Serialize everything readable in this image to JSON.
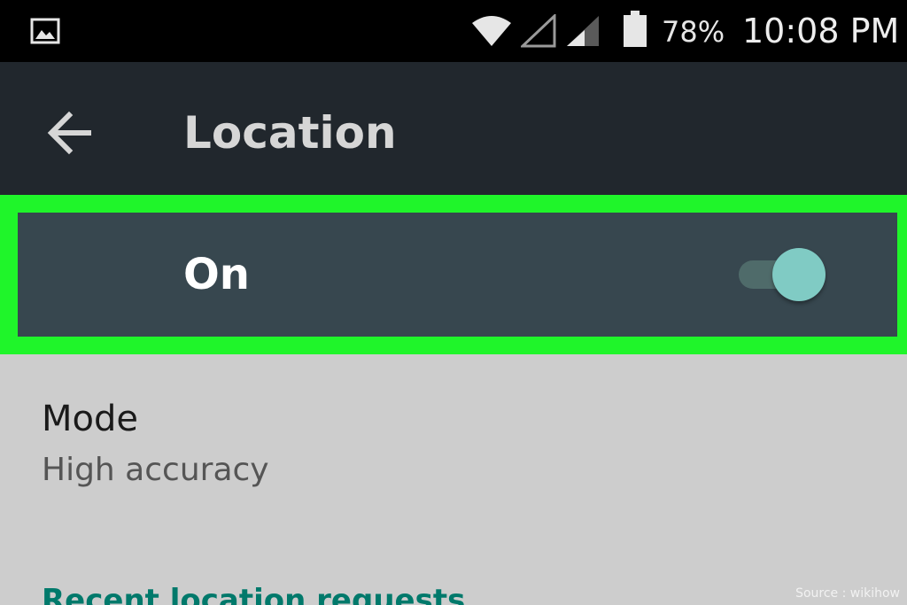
{
  "status_bar": {
    "battery_percent": "78%",
    "time": "10:08 PM",
    "icons": [
      "gallery-icon",
      "wifi-icon",
      "cell-signal-icon",
      "cell-signal-icon",
      "battery-icon"
    ]
  },
  "app_bar": {
    "title": "Location",
    "back_icon": "arrow-left-icon"
  },
  "master_switch": {
    "label": "On",
    "checked": true,
    "thumb_color": "#80cbc4",
    "track_color": "#4f6b6a",
    "highlight_color": "#1ff52a"
  },
  "settings": {
    "mode": {
      "title": "Mode",
      "value": "High accuracy"
    },
    "recent_requests_header": "Recent location requests"
  },
  "watermark": "Source : wikihow",
  "colors": {
    "status_bar_bg": "#000000",
    "app_bar_bg": "#21272d",
    "row_bg": "#37474f",
    "content_bg": "#cdcdcd",
    "accent": "#00796b"
  }
}
